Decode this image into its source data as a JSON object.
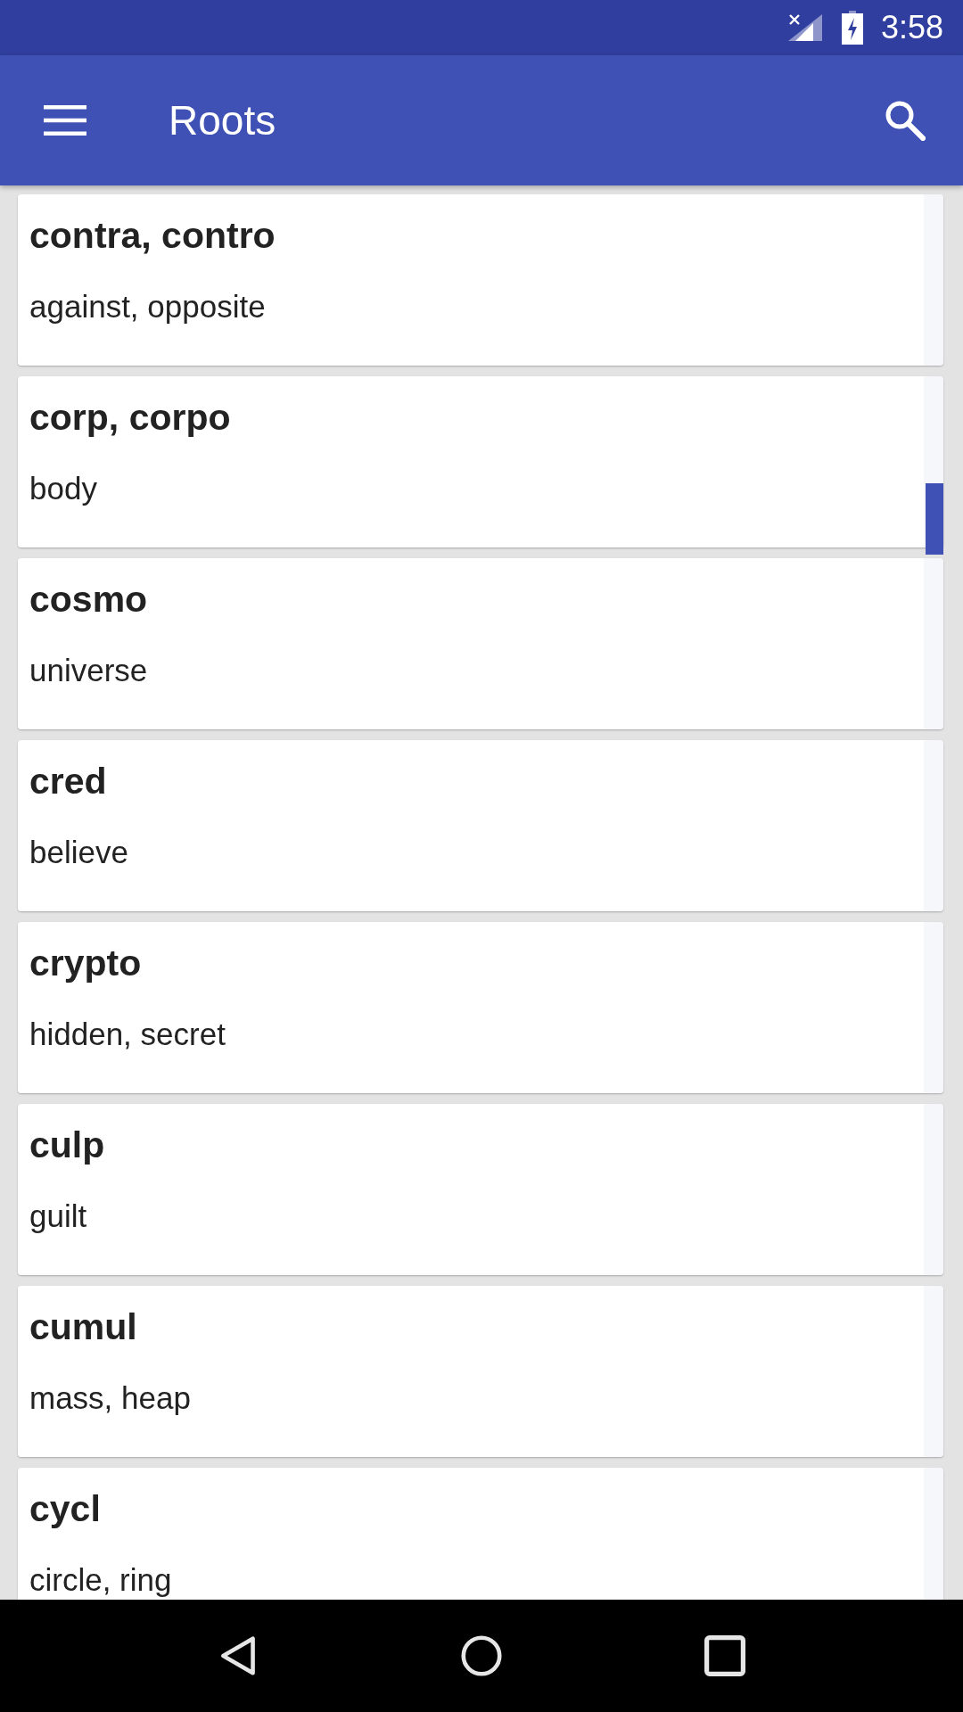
{
  "status_bar": {
    "time": "3:58"
  },
  "app_bar": {
    "title": "Roots"
  },
  "roots": [
    {
      "root": "contra, contro",
      "meaning": "against, opposite"
    },
    {
      "root": "corp, corpo",
      "meaning": "body"
    },
    {
      "root": "cosmo",
      "meaning": "universe"
    },
    {
      "root": "cred",
      "meaning": "believe"
    },
    {
      "root": "crypto",
      "meaning": "hidden, secret"
    },
    {
      "root": "culp",
      "meaning": "guilt"
    },
    {
      "root": "cumul",
      "meaning": "mass, heap"
    },
    {
      "root": "cycl",
      "meaning": "circle, ring"
    }
  ]
}
